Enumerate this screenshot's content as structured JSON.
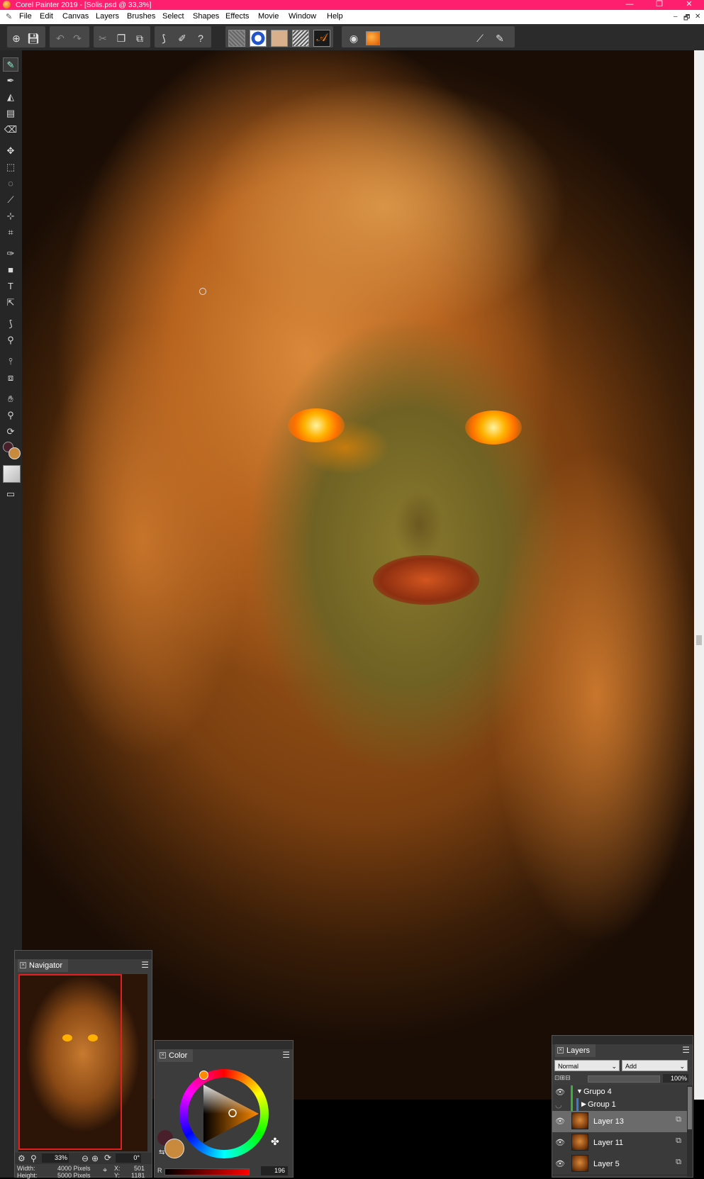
{
  "window": {
    "title": "Corel Painter 2019 - [Solis.psd @ 33,3%]",
    "controls": {
      "minimize": "—",
      "restore": "❐",
      "close": "✕"
    }
  },
  "menu": {
    "items": [
      "File",
      "Edit",
      "Canvas",
      "Layers",
      "Brushes",
      "Select",
      "Shapes",
      "Effects",
      "Movie",
      "Window",
      "Help"
    ],
    "doc_controls": {
      "minimize": "–",
      "restore": "🗗",
      "close": "✕"
    }
  },
  "toolbar": {
    "icons": [
      "new-document-icon",
      "save-icon",
      "undo-icon",
      "redo-icon",
      "cut-icon",
      "copy-icon",
      "paste-icon",
      "brush-tracking-icon",
      "brush-controls-icon",
      "help-icon"
    ]
  },
  "tools": [
    "brush",
    "dropper",
    "paint-bucket",
    "gradient",
    "eraser",
    "layer-adjuster",
    "rectangular-selection",
    "lasso",
    "magic-wand",
    "selection-adjuster",
    "crop",
    "pen",
    "rectangle-shape",
    "text",
    "shape-selection",
    "blender",
    "cloner",
    "mirror",
    "transform",
    "grabber",
    "magnifier",
    "rotate-page",
    "color-swatches",
    "paper",
    "screen-mode"
  ],
  "colors": {
    "titlebar": "#ff1f6e",
    "main_color": "#c98a3e",
    "additional_color": "#4a1f2c"
  },
  "navigator": {
    "tab": "Navigator",
    "zoom": "33%",
    "rotation": "0°",
    "width_label": "Width:",
    "width_value": "4000 Pixels",
    "height_label": "Height:",
    "height_value": "5000 Pixels",
    "x_label": "X:",
    "x_value": "501",
    "y_label": "Y:",
    "y_value": "1181"
  },
  "color_panel": {
    "tab": "Color",
    "r_label": "R",
    "r_value": "196"
  },
  "layers": {
    "tab": "Layers",
    "composite_method": "Normal",
    "composite_depth": "Add",
    "opacity": "100%",
    "items": [
      {
        "name": "Grupo 4",
        "type": "group",
        "expanded": true
      },
      {
        "name": "Group 1",
        "type": "group",
        "expanded": false
      },
      {
        "name": "Layer 13",
        "type": "layer",
        "selected": true
      },
      {
        "name": "Layer 11",
        "type": "layer",
        "selected": false
      },
      {
        "name": "Layer 5",
        "type": "layer",
        "selected": false
      }
    ]
  }
}
